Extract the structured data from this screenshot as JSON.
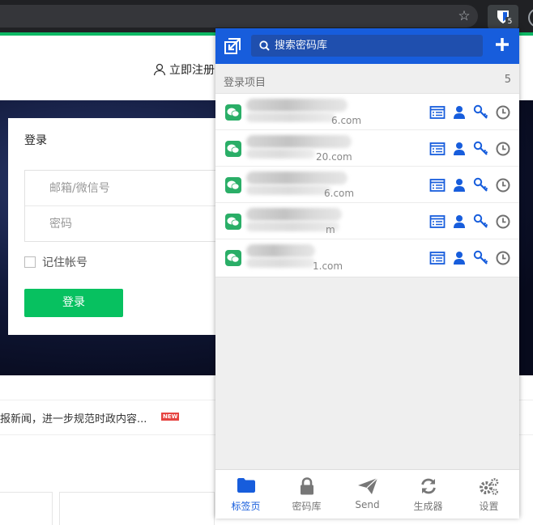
{
  "browser": {
    "extension_badge": "5",
    "icons": [
      "star-add-icon",
      "bitwarden-shield-icon",
      "profile-icon"
    ]
  },
  "site": {
    "register_label": "立即注册",
    "login": {
      "title": "登录",
      "email_placeholder": "邮箱/微信号",
      "password_placeholder": "密码",
      "remember_label": "记住帐号",
      "submit_label": "登录"
    },
    "news": {
      "text": "报新闻，进一步规范时政内容...",
      "badge": "NEW"
    },
    "colors": {
      "brand_green": "#07c160",
      "top_bar": "#0db864"
    }
  },
  "popup": {
    "search_placeholder": "搜索密码库",
    "section_title": "登录项目",
    "section_count": "5",
    "items": [
      {
        "subtitle_tail": "6.com"
      },
      {
        "subtitle_tail": "20.com"
      },
      {
        "subtitle_tail": "6.com"
      },
      {
        "subtitle_tail": "m"
      },
      {
        "subtitle_tail": "1.com"
      }
    ],
    "item_actions": [
      "launch-icon",
      "copy-username-icon",
      "copy-password-icon",
      "totp-clock-icon"
    ],
    "tabs": [
      {
        "label": "标签页",
        "icon": "folder-icon",
        "active": true
      },
      {
        "label": "密码库",
        "icon": "lock-icon",
        "active": false
      },
      {
        "label": "Send",
        "icon": "send-icon",
        "active": false
      },
      {
        "label": "生成器",
        "icon": "refresh-icon",
        "active": false
      },
      {
        "label": "设置",
        "icon": "gears-icon",
        "active": false
      }
    ],
    "colors": {
      "header": "#175ddc",
      "action_icon": "#175ddc",
      "clock_icon": "#707070"
    }
  }
}
